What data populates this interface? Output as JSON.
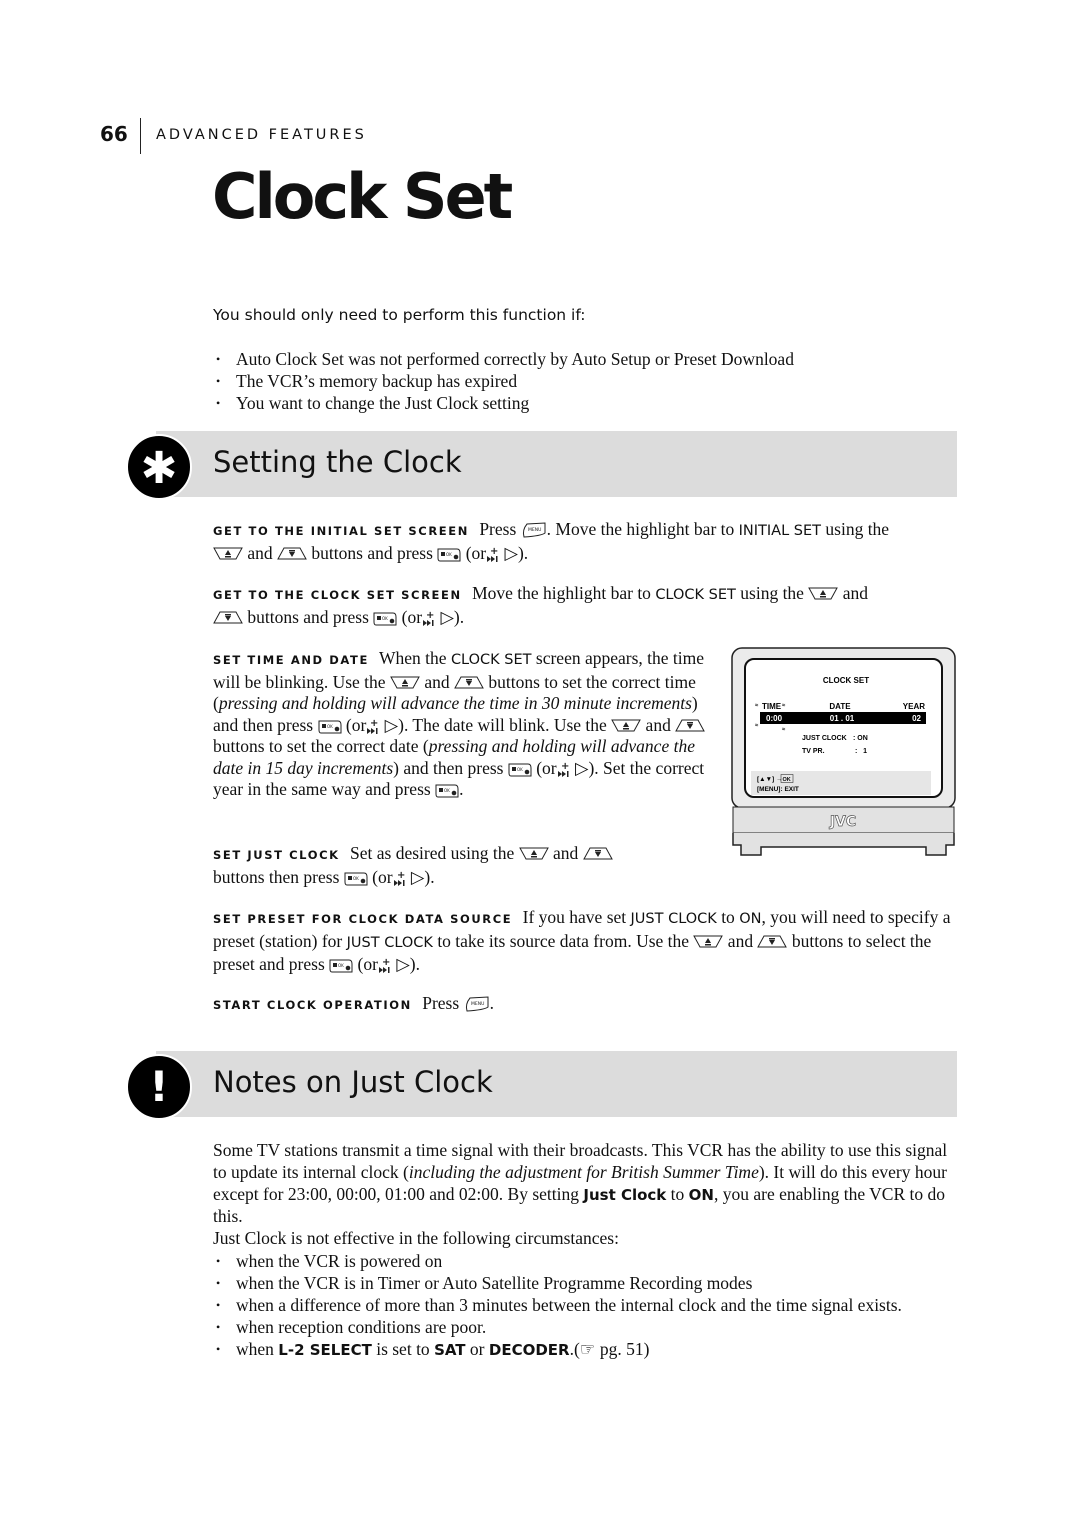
{
  "header": {
    "page_number": "66",
    "section": "ADVANCED FEATURES",
    "title": "Clock Set"
  },
  "intro": {
    "heading": "You should only need to perform this function if:",
    "items": [
      "Auto Clock Set was not performed correctly by Auto Setup or Preset Download",
      "The VCR’s memory backup has expired",
      "You want to change the Just Clock setting"
    ]
  },
  "setting_section": {
    "icon": "asterisk-icon",
    "title": "Setting the Clock",
    "steps": {
      "initial": {
        "label": "GET TO THE INITIAL SET SCREEN",
        "t1": "Press",
        "t2": ". Move the highlight bar to",
        "kw1": "INITIAL SET",
        "t3": "using the",
        "t4": "and",
        "t5": "buttons and press",
        "t6": "(or",
        "t7": ")."
      },
      "clock": {
        "label": "GET TO THE CLOCK SET SCREEN",
        "t1": "Move the highlight bar to",
        "kw1": "CLOCK SET",
        "t2": "using the",
        "t3": "and",
        "t4": "buttons and press",
        "t5": "(or",
        "t6": ")."
      },
      "time_date": {
        "label": "SET TIME AND DATE",
        "t1": "When the",
        "kw1": "CLOCK SET",
        "t2": "screen appears, the time will be blinking. Use the",
        "t3": "and",
        "t4": "buttons to set the correct time (",
        "em1": "pressing and holding will advance the time in 30 minute increments",
        "t5": ") and then press",
        "t6": "(or",
        "t7": "). The date will blink. Use the",
        "t8": "and",
        "t9": "buttons to set the correct date (",
        "em2": "pressing and holding will advance the date in 15 day increments",
        "t10": ") and then press",
        "t11": "(or",
        "t12": "). Set the correct year in the same way and press",
        "t13": "."
      },
      "just_clock": {
        "label": "SET JUST CLOCK",
        "t1": "Set as desired using the",
        "t2": "and",
        "t3": "buttons then press",
        "t4": "(or",
        "t5": ")."
      },
      "preset": {
        "label": "SET PRESET FOR CLOCK DATA SOURCE",
        "t1": "If you have set",
        "kw1": "JUST CLOCK",
        "t2": "to",
        "kw2": "ON",
        "t3": ", you will need to specify a preset (station) for",
        "kw3": "JUST CLOCK",
        "t4": "to take its source data from. Use the",
        "t5": "and",
        "t6": "buttons to select the preset and press",
        "t7": "(or",
        "t8": ")."
      },
      "start": {
        "label": "START CLOCK OPERATION",
        "t1": "Press",
        "t2": "."
      }
    },
    "tv_screen": {
      "title": "CLOCK SET",
      "col_time": "TIME",
      "col_date": "DATE",
      "col_year": "YEAR",
      "time_value": "0:00",
      "date_value": "01 . 01",
      "year_value": "02",
      "just_clock_label": "JUST CLOCK",
      "just_clock_value": ": ON",
      "tv_pr_label": "TV PR.",
      "tv_pr_value": ":   1",
      "hint_nav": "[▲▼] →",
      "hint_ok": "OK",
      "hint_exit": "[MENU]: EXIT",
      "brand": "JVC"
    },
    "button_icons": {
      "up": "up-arrow-button-icon",
      "down": "down-arrow-button-icon",
      "ok": "ok-button-icon",
      "menu": "menu-button-icon",
      "ff": "fast-forward-button-icon",
      "right": "right-arrow-icon"
    }
  },
  "notes_section": {
    "icon": "exclamation-icon",
    "title": "Notes on Just Clock",
    "p1_a": "Some TV stations transmit a time signal with their broadcasts. This VCR has the ability to use this signal to update its internal clock (",
    "p1_em": "including the adjustment for British Summer Time",
    "p1_b": "). It will do this every hour except for 23:00, 00:00, 01:00 and 02:00. By setting",
    "p1_kw1": "Just Clock",
    "p1_c": "to",
    "p1_kw2": "ON",
    "p1_d": ", you are enabling the VCR to do this.",
    "p2": "Just Clock is not effective in the following circumstances:",
    "items": [
      "when the VCR is powered on",
      "when the VCR is in Timer or Auto Satellite Programme Recording modes",
      "when a difference of more than 3 minutes between the internal clock and the time signal exists.",
      "when reception conditions are poor."
    ],
    "last_item": {
      "t1": "when",
      "kw1": "L-2 SELECT",
      "t2": "is set to",
      "kw2": "SAT",
      "t3": "or",
      "kw3": "DECODER",
      "t4": ".(☞ pg. 51)"
    }
  }
}
